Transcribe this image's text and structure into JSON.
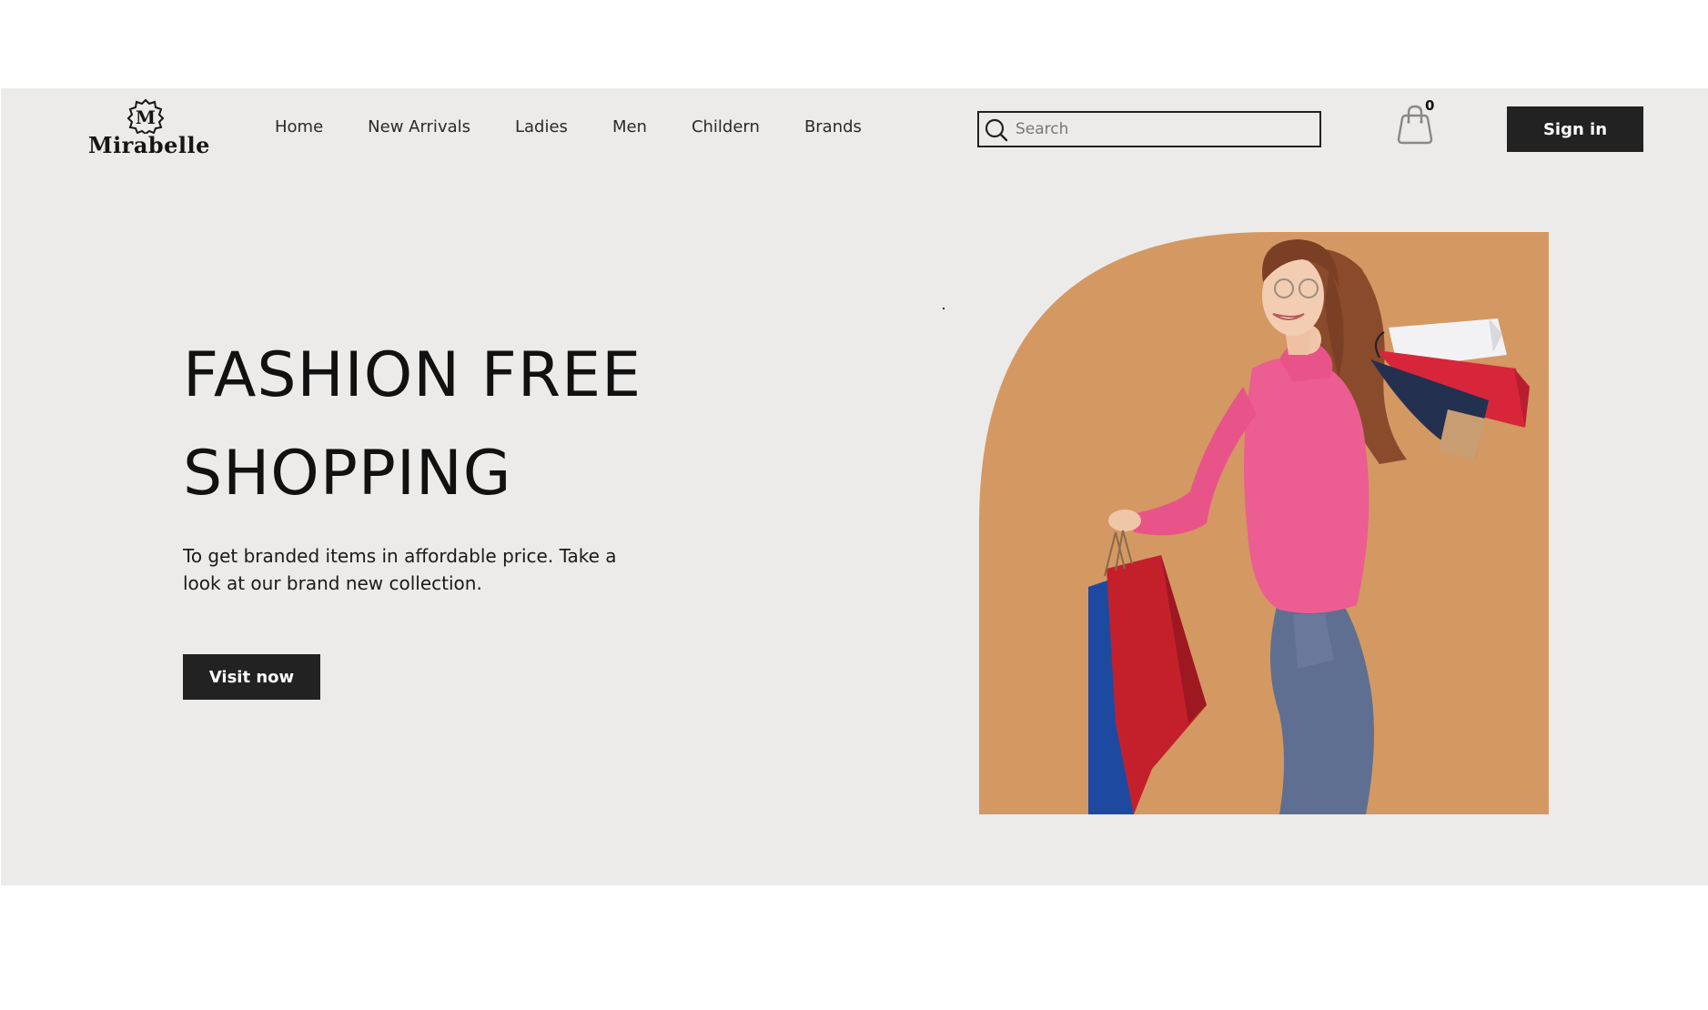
{
  "brand": {
    "name": "Mirabelle",
    "monogram": "M",
    "logo_icon": "monogram-logo-icon"
  },
  "nav": {
    "items": [
      {
        "label": "Home"
      },
      {
        "label": "New Arrivals"
      },
      {
        "label": "Ladies"
      },
      {
        "label": "Men"
      },
      {
        "label": "Childern"
      },
      {
        "label": "Brands"
      }
    ]
  },
  "search": {
    "placeholder": "Search",
    "value": "",
    "icon": "search-icon"
  },
  "cart": {
    "count": "0",
    "icon": "shopping-bag-icon"
  },
  "auth": {
    "signin_label": "Sign in"
  },
  "hero": {
    "title_line1": "FASHION FREE",
    "title_line2": "SHOPPING",
    "description": "To get branded items in affordable price. Take a look at our brand new collection.",
    "cta_label": "Visit now",
    "image": "woman-with-shopping-bags"
  },
  "colors": {
    "page_bg": "#ecebea",
    "accent_panel": "#d49863",
    "button_bg": "#222222",
    "sweater": "#ec5d91",
    "jeans": "#5f6f91"
  }
}
